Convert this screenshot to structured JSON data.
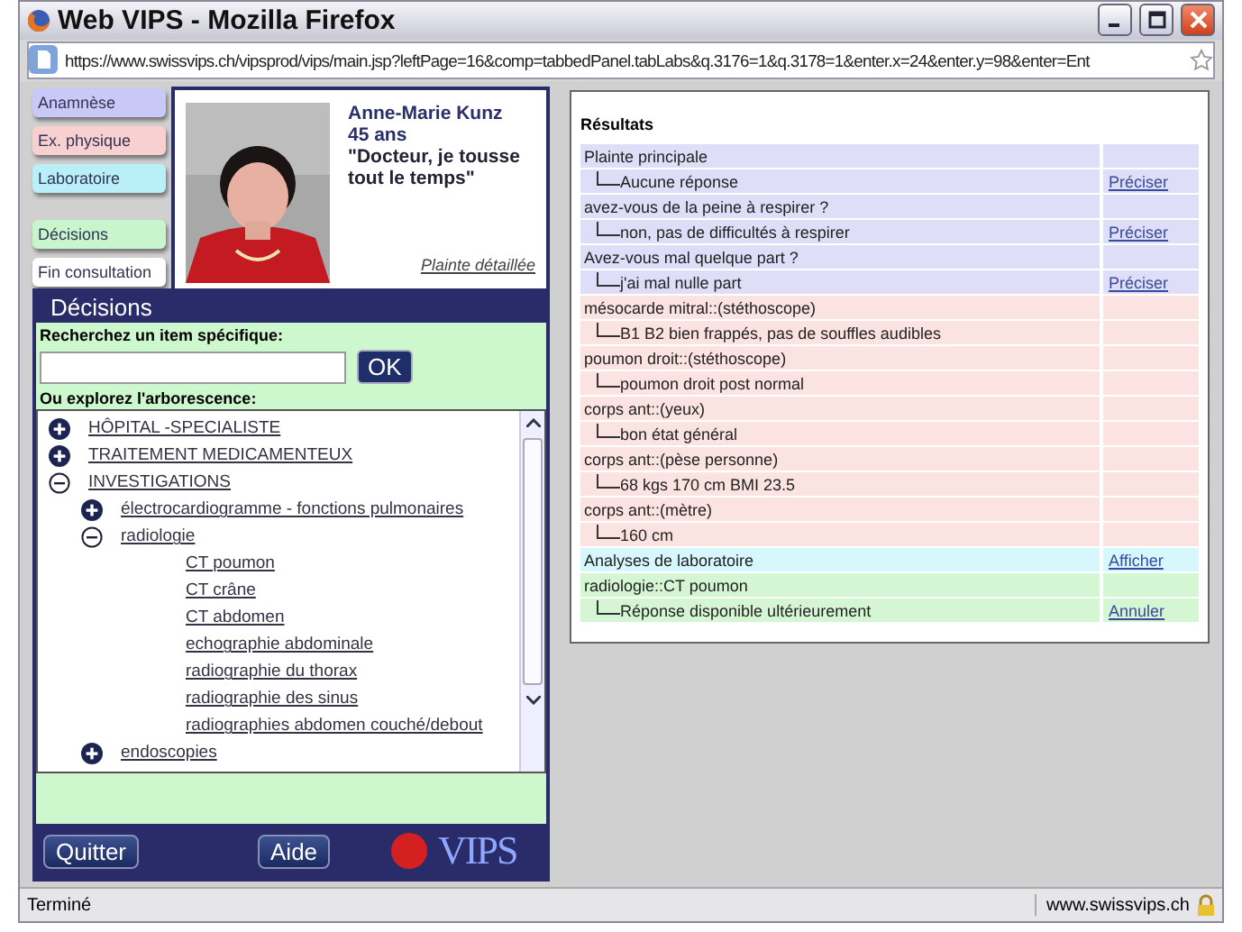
{
  "window": {
    "title": "Web VIPS - Mozilla Firefox"
  },
  "address_bar": {
    "url": "https://www.swissvips.ch/vipsprod/vips/main.jsp?leftPage=16&comp=tabbedPanel.tabLabs&q.3176=1&q.3178=1&enter.x=24&enter.y=98&enter=Ent"
  },
  "tabs": [
    {
      "label": "Anamnèse",
      "color": "#c9c9f7"
    },
    {
      "label": "Ex. physique",
      "color": "#f9d0d0"
    },
    {
      "label": "Laboratoire",
      "color": "#b9f0f7"
    },
    {
      "label": "Décisions",
      "color": "#c8f5cc"
    },
    {
      "label": "Fin consultation",
      "color": "#ffffff"
    }
  ],
  "patient": {
    "kind": "picture",
    "name": "Anne-Marie Kunz",
    "age": "45 ans",
    "complaint": "\"Docteur, je tousse tout le temps\"",
    "link": "Plainte détaillée"
  },
  "decisions": {
    "title": "Décisions",
    "search_label": "Recherchez un item spécifique:",
    "search_button": "OK",
    "tree_label": "Ou explorez l'arborescence:",
    "tree": [
      {
        "label": "HÔPITAL -SPECIALISTE",
        "kind": "folder",
        "expanded": false
      },
      {
        "label": "TRAITEMENT MEDICAMENTEUX",
        "kind": "folder",
        "expanded": false
      },
      {
        "label": "INVESTIGATIONS",
        "kind": "folder",
        "expanded": true,
        "children": [
          {
            "label": "électrocardiogramme - fonctions pulmonaires",
            "kind": "folder",
            "expanded": false
          },
          {
            "label": "radiologie",
            "kind": "folder",
            "expanded": true,
            "children": [
              {
                "label": "CT poumon",
                "kind": "leaf"
              },
              {
                "label": "CT crâne",
                "kind": "leaf"
              },
              {
                "label": "CT abdomen",
                "kind": "leaf"
              },
              {
                "label": "echographie abdominale",
                "kind": "leaf"
              },
              {
                "label": "radiographie du thorax",
                "kind": "leaf"
              },
              {
                "label": "radiographie des sinus",
                "kind": "leaf"
              },
              {
                "label": "radiographies abdomen couché/debout",
                "kind": "leaf"
              }
            ]
          },
          {
            "label": "endoscopies",
            "kind": "folder",
            "expanded": false
          }
        ]
      }
    ],
    "buttons": [
      "Quitter",
      "Aide"
    ],
    "logo": "VIPS"
  },
  "results": {
    "title": "Résultats",
    "rows": [
      {
        "text": "Plainte principale",
        "kind": "question",
        "color": "#dedef8"
      },
      {
        "text": "Aucune réponse",
        "kind": "answer",
        "color": "#dedef8",
        "link": "Préciser"
      },
      {
        "text": "avez-vous de la peine à respirer ?",
        "kind": "question",
        "color": "#dedef8"
      },
      {
        "text": "non, pas de difficultés à respirer",
        "kind": "answer",
        "color": "#dedef8",
        "link": "Préciser"
      },
      {
        "text": "Avez-vous mal quelque part ?",
        "kind": "question",
        "color": "#dedef8"
      },
      {
        "text": "j'ai mal nulle part",
        "kind": "answer",
        "color": "#dedef8",
        "link": "Préciser"
      },
      {
        "text": "mésocarde mitral::(stéthoscope)",
        "kind": "question",
        "color": "#fbe3e1"
      },
      {
        "text": "B1 B2 bien frappés, pas de souffles audibles",
        "kind": "answer",
        "color": "#fbe3e1"
      },
      {
        "text": "poumon droit::(stéthoscope)",
        "kind": "question",
        "color": "#fbe3e1"
      },
      {
        "text": "poumon droit post normal",
        "kind": "answer",
        "color": "#fbe3e1"
      },
      {
        "text": "corps ant::(yeux)",
        "kind": "question",
        "color": "#fbe3e1"
      },
      {
        "text": "bon état général",
        "kind": "answer",
        "color": "#fbe3e1"
      },
      {
        "text": "corps ant::(pèse personne)",
        "kind": "question",
        "color": "#fbe3e1"
      },
      {
        "text": "68 kgs 170 cm BMI 23.5",
        "kind": "answer",
        "color": "#fbe3e1"
      },
      {
        "text": "corps ant::(mètre)",
        "kind": "question",
        "color": "#fbe3e1"
      },
      {
        "text": "160 cm",
        "kind": "answer",
        "color": "#fbe3e1"
      },
      {
        "text": "Analyses de laboratoire",
        "kind": "question",
        "color": "#d6f7fb",
        "link": "Afficher"
      },
      {
        "text": "radiologie::CT poumon",
        "kind": "question",
        "color": "#d5f6d3"
      },
      {
        "text": "Réponse disponible ultérieurement",
        "kind": "answer",
        "color": "#d5f6d3",
        "link": "Annuler"
      }
    ]
  },
  "status_bar": {
    "text": "Terminé",
    "site": "www.swissvips.ch"
  }
}
